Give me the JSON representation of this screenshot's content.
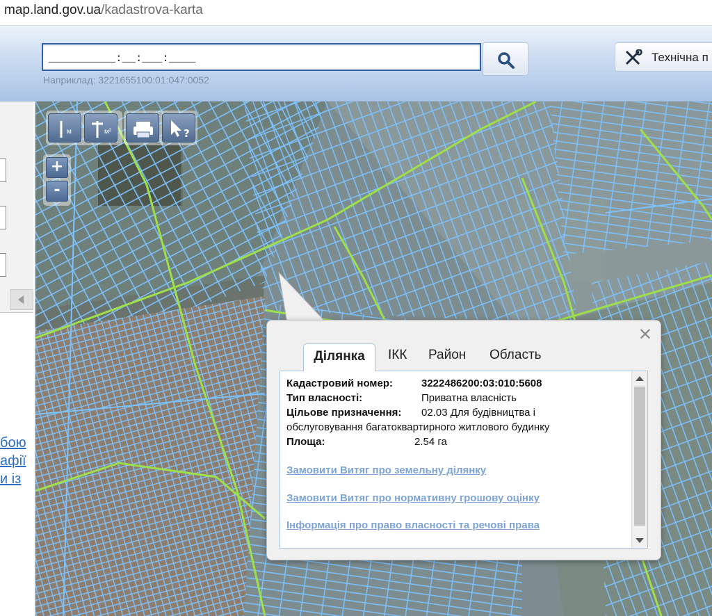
{
  "browser": {
    "url_host": "map.land.gov.ua",
    "url_path": "/kadastrova-karta"
  },
  "header": {
    "search_value": "__________:__:___:____",
    "example_text": "Наприклад: 3221655100:01:047:0052",
    "tech_button_label": "Технічна п"
  },
  "left_panel": {
    "links": [
      "бою",
      "афії",
      "и   із"
    ]
  },
  "map_tools": {
    "length_label": "м",
    "area_label": "м²",
    "zoom_in": "+",
    "zoom_out": "-"
  },
  "popup": {
    "close": "✕",
    "tabs": [
      "Ділянка",
      "ІКК",
      "Район",
      "Область"
    ],
    "fields": {
      "cadastral_label": "Кадастровий номер:",
      "cadastral_value": "3222486200:03:010:5608",
      "ownership_label": "Тип власності:",
      "ownership_value": "Приватна власність",
      "purpose_label": "Цільове призначення:",
      "purpose_value_line1": "02.03 Для будівництва і",
      "purpose_value_line2": "обслуговування багатоквартирного житлового будинку",
      "area_label": "Площа:",
      "area_value": "2.54 га"
    },
    "links": [
      "Замовити Витяг про земельну ділянку",
      "Замовити Витяг про нормативну грошову оцінку",
      "Інформація про право власності та речові права"
    ]
  },
  "colors": {
    "parcel_border": "#7cc2ff",
    "admin_border": "#9fe04a",
    "link_color": "#7ea3d6"
  }
}
